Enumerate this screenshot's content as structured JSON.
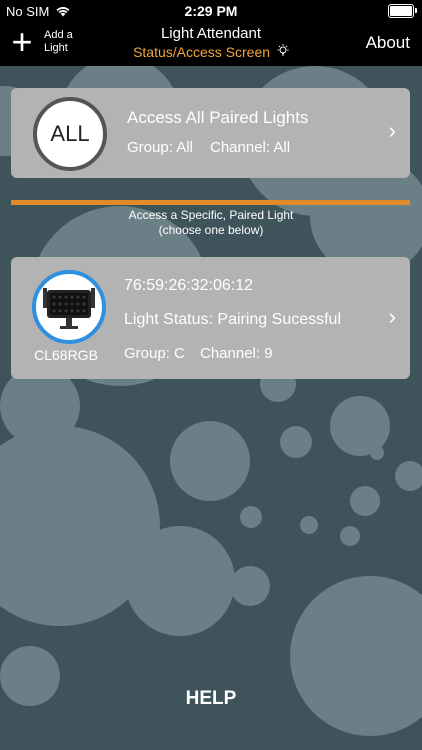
{
  "status_bar": {
    "carrier": "No SIM",
    "time": "2:29 PM"
  },
  "nav": {
    "add_label_line1": "Add a",
    "add_label_line2": "Light",
    "title": "Light Attendant",
    "subtitle": "Status/Access Screen",
    "about": "About"
  },
  "all_card": {
    "badge": "ALL",
    "title": "Access All Paired Lights",
    "group": "Group: All",
    "channel": "Channel: All"
  },
  "section": {
    "line1": "Access a Specific, Paired Light",
    "line2": "(choose one below)"
  },
  "light_card": {
    "name": "CL68RGB",
    "address": "76:59:26:32:06:12",
    "status": "Light Status: Pairing Sucessful",
    "group": "Group: C",
    "channel": "Channel: 9"
  },
  "help": "HELP",
  "colors": {
    "accent": "#e08a2a",
    "subtitle": "#f0a63a",
    "light_ring": "#2f8fe0",
    "background": "#3f535b"
  }
}
